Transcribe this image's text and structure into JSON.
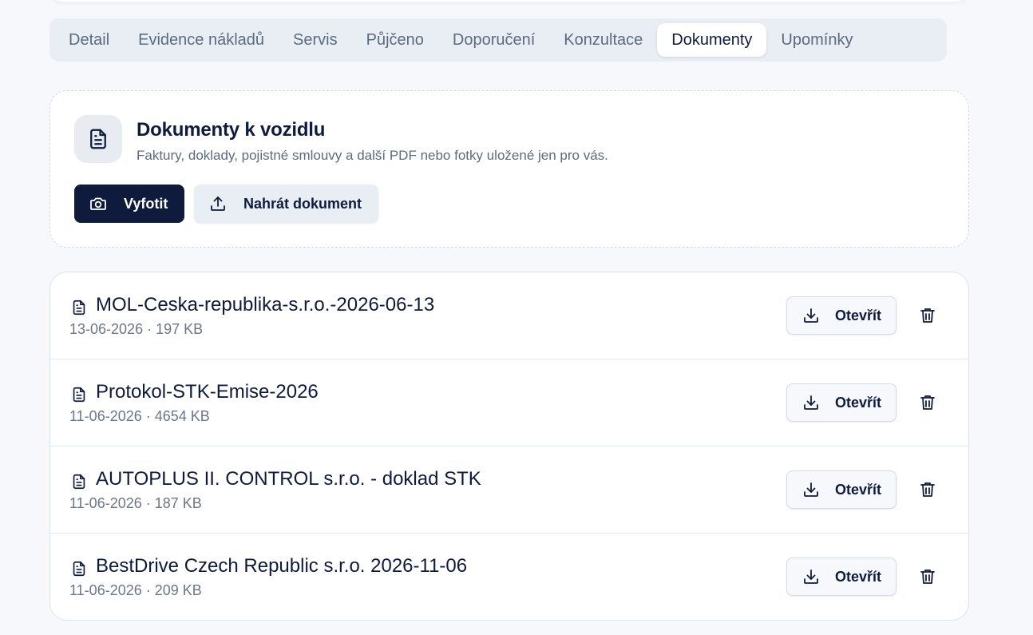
{
  "tabs": [
    {
      "label": "Detail",
      "active": false
    },
    {
      "label": "Evidence nákladů",
      "active": false
    },
    {
      "label": "Servis",
      "active": false
    },
    {
      "label": "Půjčeno",
      "active": false
    },
    {
      "label": "Doporučení",
      "active": false
    },
    {
      "label": "Konzultace",
      "active": false
    },
    {
      "label": "Dokumenty",
      "active": true
    },
    {
      "label": "Upomínky",
      "active": false
    }
  ],
  "upload": {
    "title": "Dokumenty k vozidlu",
    "subtitle": "Faktury, doklady, pojistné smlouvy a další PDF nebo fotky uložené jen pro vás.",
    "photo_button": "Vyfotit",
    "upload_button": "Nahrát dokument",
    "icons": {
      "badge": "document-icon",
      "photo": "camera-icon",
      "upload": "upload-icon"
    }
  },
  "documents": [
    {
      "name": "MOL-Ceska-republika-s.r.o.-2026-06-13",
      "meta": "13-06-2026 · 197 KB",
      "open_label": "Otevřít"
    },
    {
      "name": "Protokol-STK-Emise-2026",
      "meta": "11-06-2026 · 4654 KB",
      "open_label": "Otevřít"
    },
    {
      "name": "AUTOPLUS II. CONTROL s.r.o. - doklad STK",
      "meta": "11-06-2026 · 187 KB",
      "open_label": "Otevřít"
    },
    {
      "name": "BestDrive Czech Republic s.r.o. 2026-11-06",
      "meta": "11-06-2026 · 209 KB",
      "open_label": "Otevřít"
    }
  ],
  "colors": {
    "primary": "#0f1b3d",
    "muted_text": "#5b6b80",
    "tab_bar_bg": "#e9eef4",
    "page_bg": "#f6f8fb"
  }
}
